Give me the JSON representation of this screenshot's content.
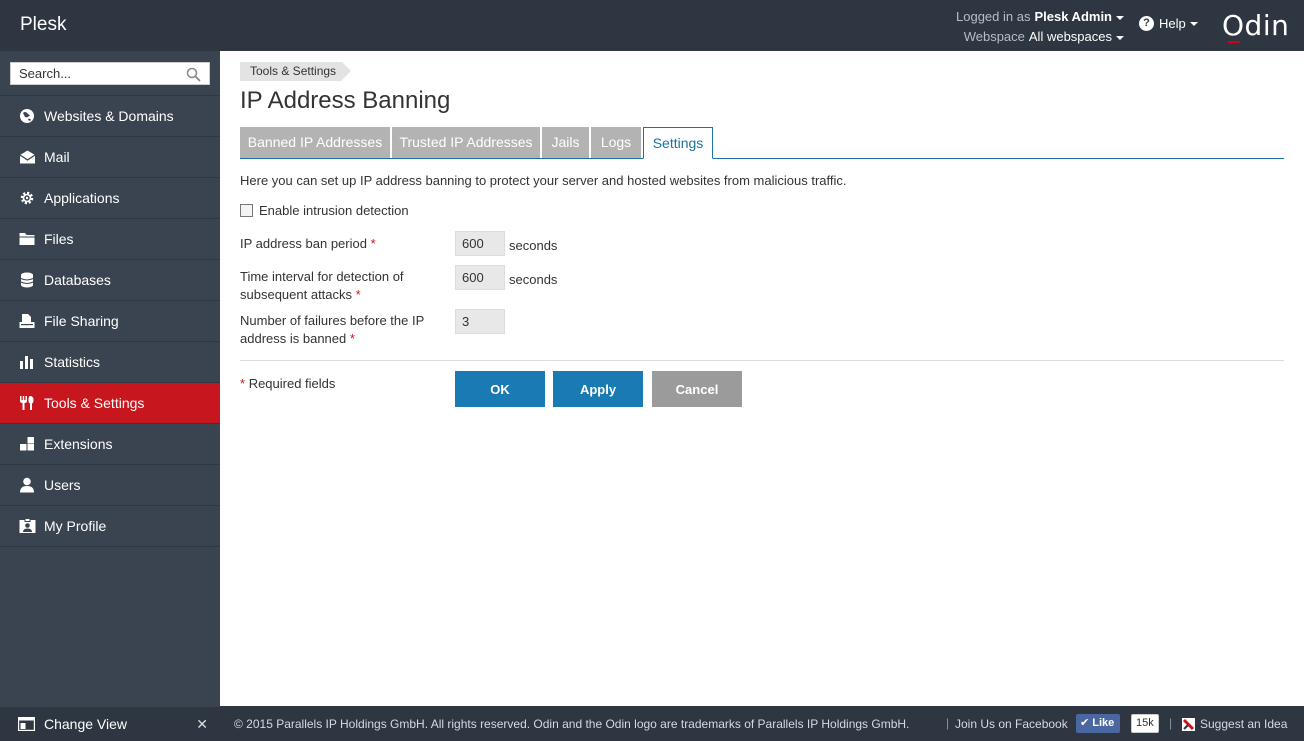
{
  "header": {
    "brand": "Plesk",
    "logged_in_label": "Logged in as",
    "user": "Plesk Admin",
    "webspace_label": "Webspace",
    "webspace": "All webspaces",
    "help": "Help",
    "vendor_logo": "Odin"
  },
  "sidebar": {
    "search_placeholder": "Search...",
    "items": [
      {
        "label": "Websites & Domains",
        "icon": "globe-icon"
      },
      {
        "label": "Mail",
        "icon": "envelope-icon"
      },
      {
        "label": "Applications",
        "icon": "gear-icon"
      },
      {
        "label": "Files",
        "icon": "folder-icon"
      },
      {
        "label": "Databases",
        "icon": "database-icon"
      },
      {
        "label": "File Sharing",
        "icon": "file-sharing-icon"
      },
      {
        "label": "Statistics",
        "icon": "bar-chart-icon"
      },
      {
        "label": "Tools & Settings",
        "icon": "tools-icon",
        "active": true
      },
      {
        "label": "Extensions",
        "icon": "puzzle-icon"
      },
      {
        "label": "Users",
        "icon": "user-icon"
      },
      {
        "label": "My Profile",
        "icon": "profile-icon"
      }
    ],
    "change_view": "Change View"
  },
  "main": {
    "breadcrumb": "Tools & Settings",
    "title": "IP Address Banning",
    "tabs": [
      {
        "label": "Banned IP Addresses"
      },
      {
        "label": "Trusted IP Addresses"
      },
      {
        "label": "Jails"
      },
      {
        "label": "Logs"
      },
      {
        "label": "Settings",
        "active": true
      }
    ],
    "intro": "Here you can set up IP address banning to protect your server and hosted websites from malicious traffic.",
    "enable_label": "Enable intrusion detection",
    "fields": {
      "ban_period": {
        "label": "IP address ban period",
        "value": "600",
        "unit": "seconds"
      },
      "interval": {
        "label_line1": "Time interval for detection of",
        "label_line2": "subsequent attacks",
        "value": "600",
        "unit": "seconds"
      },
      "failures": {
        "label_line1": "Number of failures before the IP",
        "label_line2": "address is banned",
        "value": "3"
      }
    },
    "required_star": "*",
    "required_note": "Required fields",
    "buttons": {
      "ok": "OK",
      "apply": "Apply",
      "cancel": "Cancel"
    }
  },
  "footer": {
    "copyright": "© 2015 Parallels IP Holdings GmbH. All rights reserved. Odin and the Odin logo are trademarks of Parallels IP Holdings GmbH.",
    "facebook": "Join Us on Facebook",
    "like": "Like",
    "like_count": "15k",
    "suggest": "Suggest an Idea"
  },
  "colors": {
    "header_bg": "#2d3641",
    "sidebar_bg": "#3a4350",
    "active_nav": "#c7161d",
    "primary_button": "#1a7ab3",
    "tab_inactive": "#b3b3b3"
  }
}
